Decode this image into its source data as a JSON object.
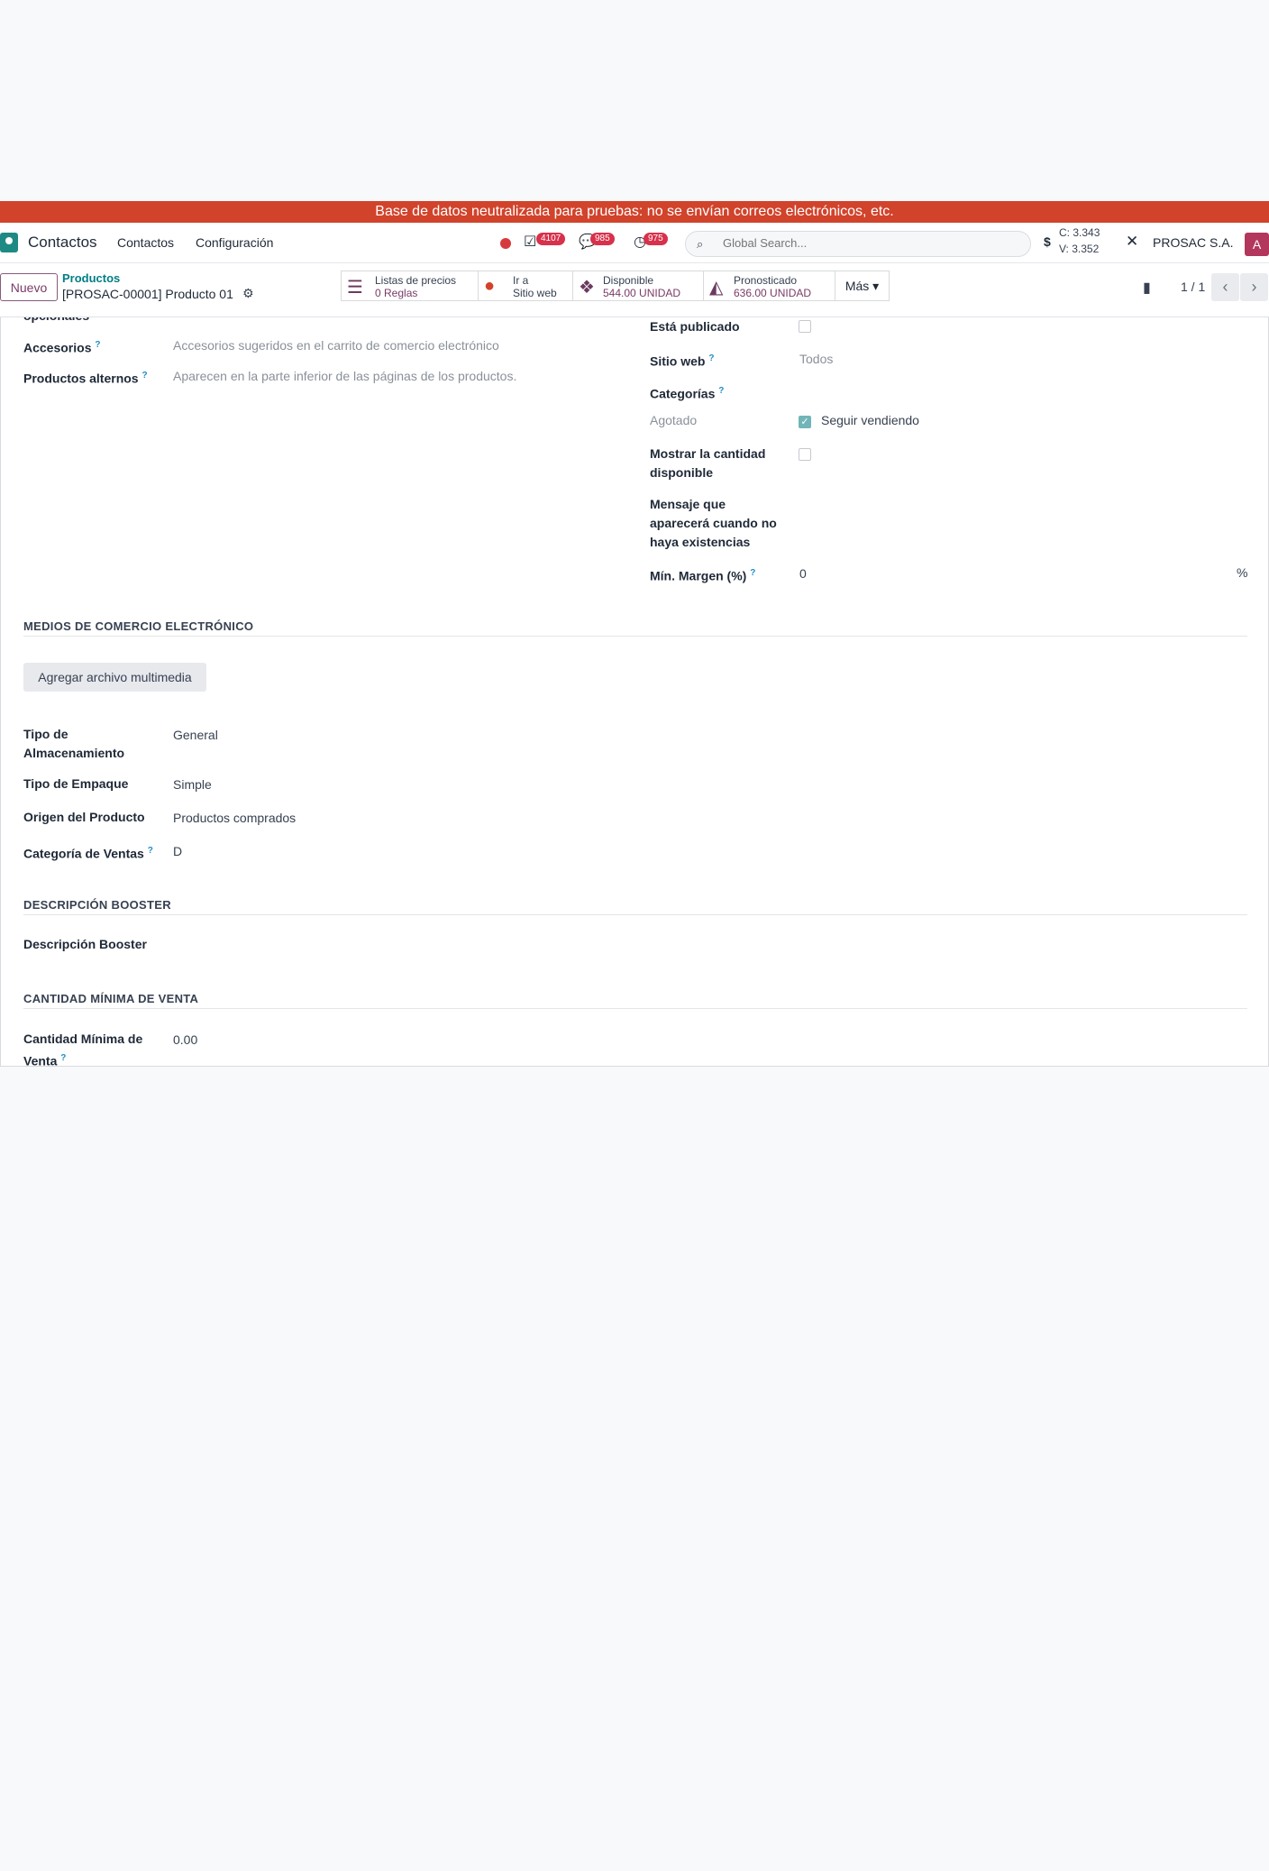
{
  "banner": "Base de datos neutralizada para pruebas: no se envían correos electrónicos, etc.",
  "navbar": {
    "app_name": "Contactos",
    "menu": [
      "Contactos",
      "Configuración"
    ],
    "activity_count": "4107",
    "messages_count": "985",
    "clock_count": "975",
    "search_placeholder": "Global Search...",
    "currency_c": "C: 3.343",
    "currency_v": "V: 3.352",
    "company": "PROSAC S.A.",
    "avatar_letter": "A"
  },
  "control": {
    "new_label": "Nuevo",
    "breadcrumb_parent": "Productos",
    "breadcrumb_record": "[PROSAC-00001] Producto 01",
    "smart_buttons": [
      {
        "label": "Listas de precios",
        "value": "0 Reglas",
        "icon": "list-icon"
      },
      {
        "label": "Ir a",
        "value": "Sitio web",
        "icon": "globe-icon"
      },
      {
        "label": "Disponible",
        "value": "544.00 UNIDAD",
        "icon": "cubes-icon"
      },
      {
        "label": "Pronosticado",
        "value": "636.00 UNIDAD",
        "icon": "area-chart-icon"
      }
    ],
    "more_label": "Más",
    "pager": "1 / 1"
  },
  "form": {
    "cut_label": "opcionales",
    "accessories_label": "Accesorios",
    "accessories_placeholder": "Accesorios sugeridos en el carrito de comercio electrónico",
    "alternatives_label": "Productos alternos",
    "alternatives_placeholder": "Aparecen en la parte inferior de las páginas de los productos.",
    "published_label": "Está publicado",
    "website_label": "Sitio web",
    "website_value": "Todos",
    "categories_label": "Categorías",
    "out_of_stock_label": "Agotado",
    "continue_selling_label": "Seguir vendiendo",
    "show_qty_label_1": "Mostrar la cantidad",
    "show_qty_label_2": "disponible",
    "message_label_1": "Mensaje que",
    "message_label_2": "aparecerá cuando no",
    "message_label_3": "haya existencias",
    "margin_label": "Mín. Margen (%)",
    "margin_value": "0",
    "margin_unit": "%",
    "section_media": "MEDIOS DE COMERCIO ELECTRÓNICO",
    "add_media_label": "Agregar archivo multimedia",
    "storage_label_1": "Tipo de",
    "storage_label_2": "Almacenamiento",
    "storage_value": "General",
    "packaging_label": "Tipo de Empaque",
    "packaging_value": "Simple",
    "origin_label": "Origen del Producto",
    "origin_value": "Productos comprados",
    "sales_category_label": "Categoría de Ventas",
    "sales_category_value": "D",
    "section_booster": "DESCRIPCIÓN BOOSTER",
    "booster_label": "Descripción Booster",
    "section_min_qty": "CANTIDAD MÍNIMA DE VENTA",
    "min_qty_label_1": "Cantidad Mínima de",
    "min_qty_label_2": "Venta",
    "min_qty_value": "0.00",
    "help_mark": "?"
  }
}
